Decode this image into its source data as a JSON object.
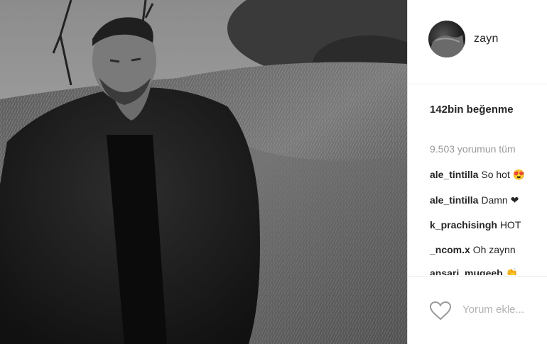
{
  "post": {
    "username": "zayn",
    "likes_text": "142bin beğenme",
    "view_all_comments": "9.503 yorumun tüm",
    "comments": [
      {
        "user": "ale_tintilla",
        "text": "So hot 😍"
      },
      {
        "user": "ale_tintilla",
        "text": "Damn ❤"
      },
      {
        "user": "k_prachisingh",
        "text": "HOT"
      },
      {
        "user": "_ncom.x",
        "text": "Oh zaynn"
      },
      {
        "user": "ansari_mugeeb",
        "text": "👏"
      }
    ],
    "add_comment_placeholder": "Yorum ekle..."
  },
  "icons": {
    "like": "heart-outline-icon",
    "avatar": "profile-avatar"
  },
  "colors": {
    "text": "#262626",
    "muted": "#999999",
    "placeholder": "#b3b3b3",
    "border": "#efefef"
  }
}
